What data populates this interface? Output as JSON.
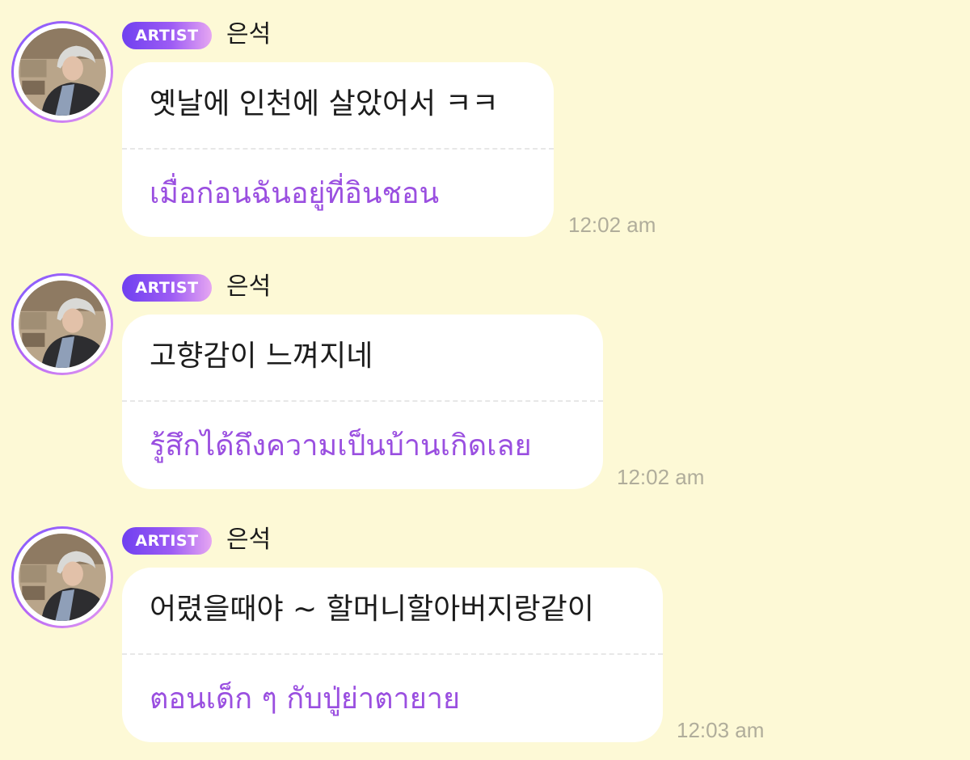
{
  "colors": {
    "background": "#fdf9d6",
    "badge_gradient_start": "#6f40f0",
    "badge_gradient_end": "#e6a6f2",
    "translation_text": "#9a4fe0",
    "timestamp_text": "#b0ad9b",
    "bubble": "#ffffff"
  },
  "messages": [
    {
      "avatar_icon": "artist-profile-photo",
      "badge": "ARTIST",
      "sender": "은석",
      "text": "옛날에 인천에 살았어서 ㅋㅋ",
      "translation": "เมื่อก่อนฉันอยู่ที่อินชอน",
      "time": "12:02 am"
    },
    {
      "avatar_icon": "artist-profile-photo",
      "badge": "ARTIST",
      "sender": "은석",
      "text": "고향감이 느껴지네",
      "translation": "รู้สึกได้ถึงความเป็นบ้านเกิดเลย",
      "time": "12:02 am"
    },
    {
      "avatar_icon": "artist-profile-photo",
      "badge": "ARTIST",
      "sender": "은석",
      "text": "어렸을때야 ~ 할머니할아버지랑같이",
      "translation": "ตอนเด็ก ๆ กับปู่ย่าตายาย",
      "time": "12:03 am"
    }
  ]
}
